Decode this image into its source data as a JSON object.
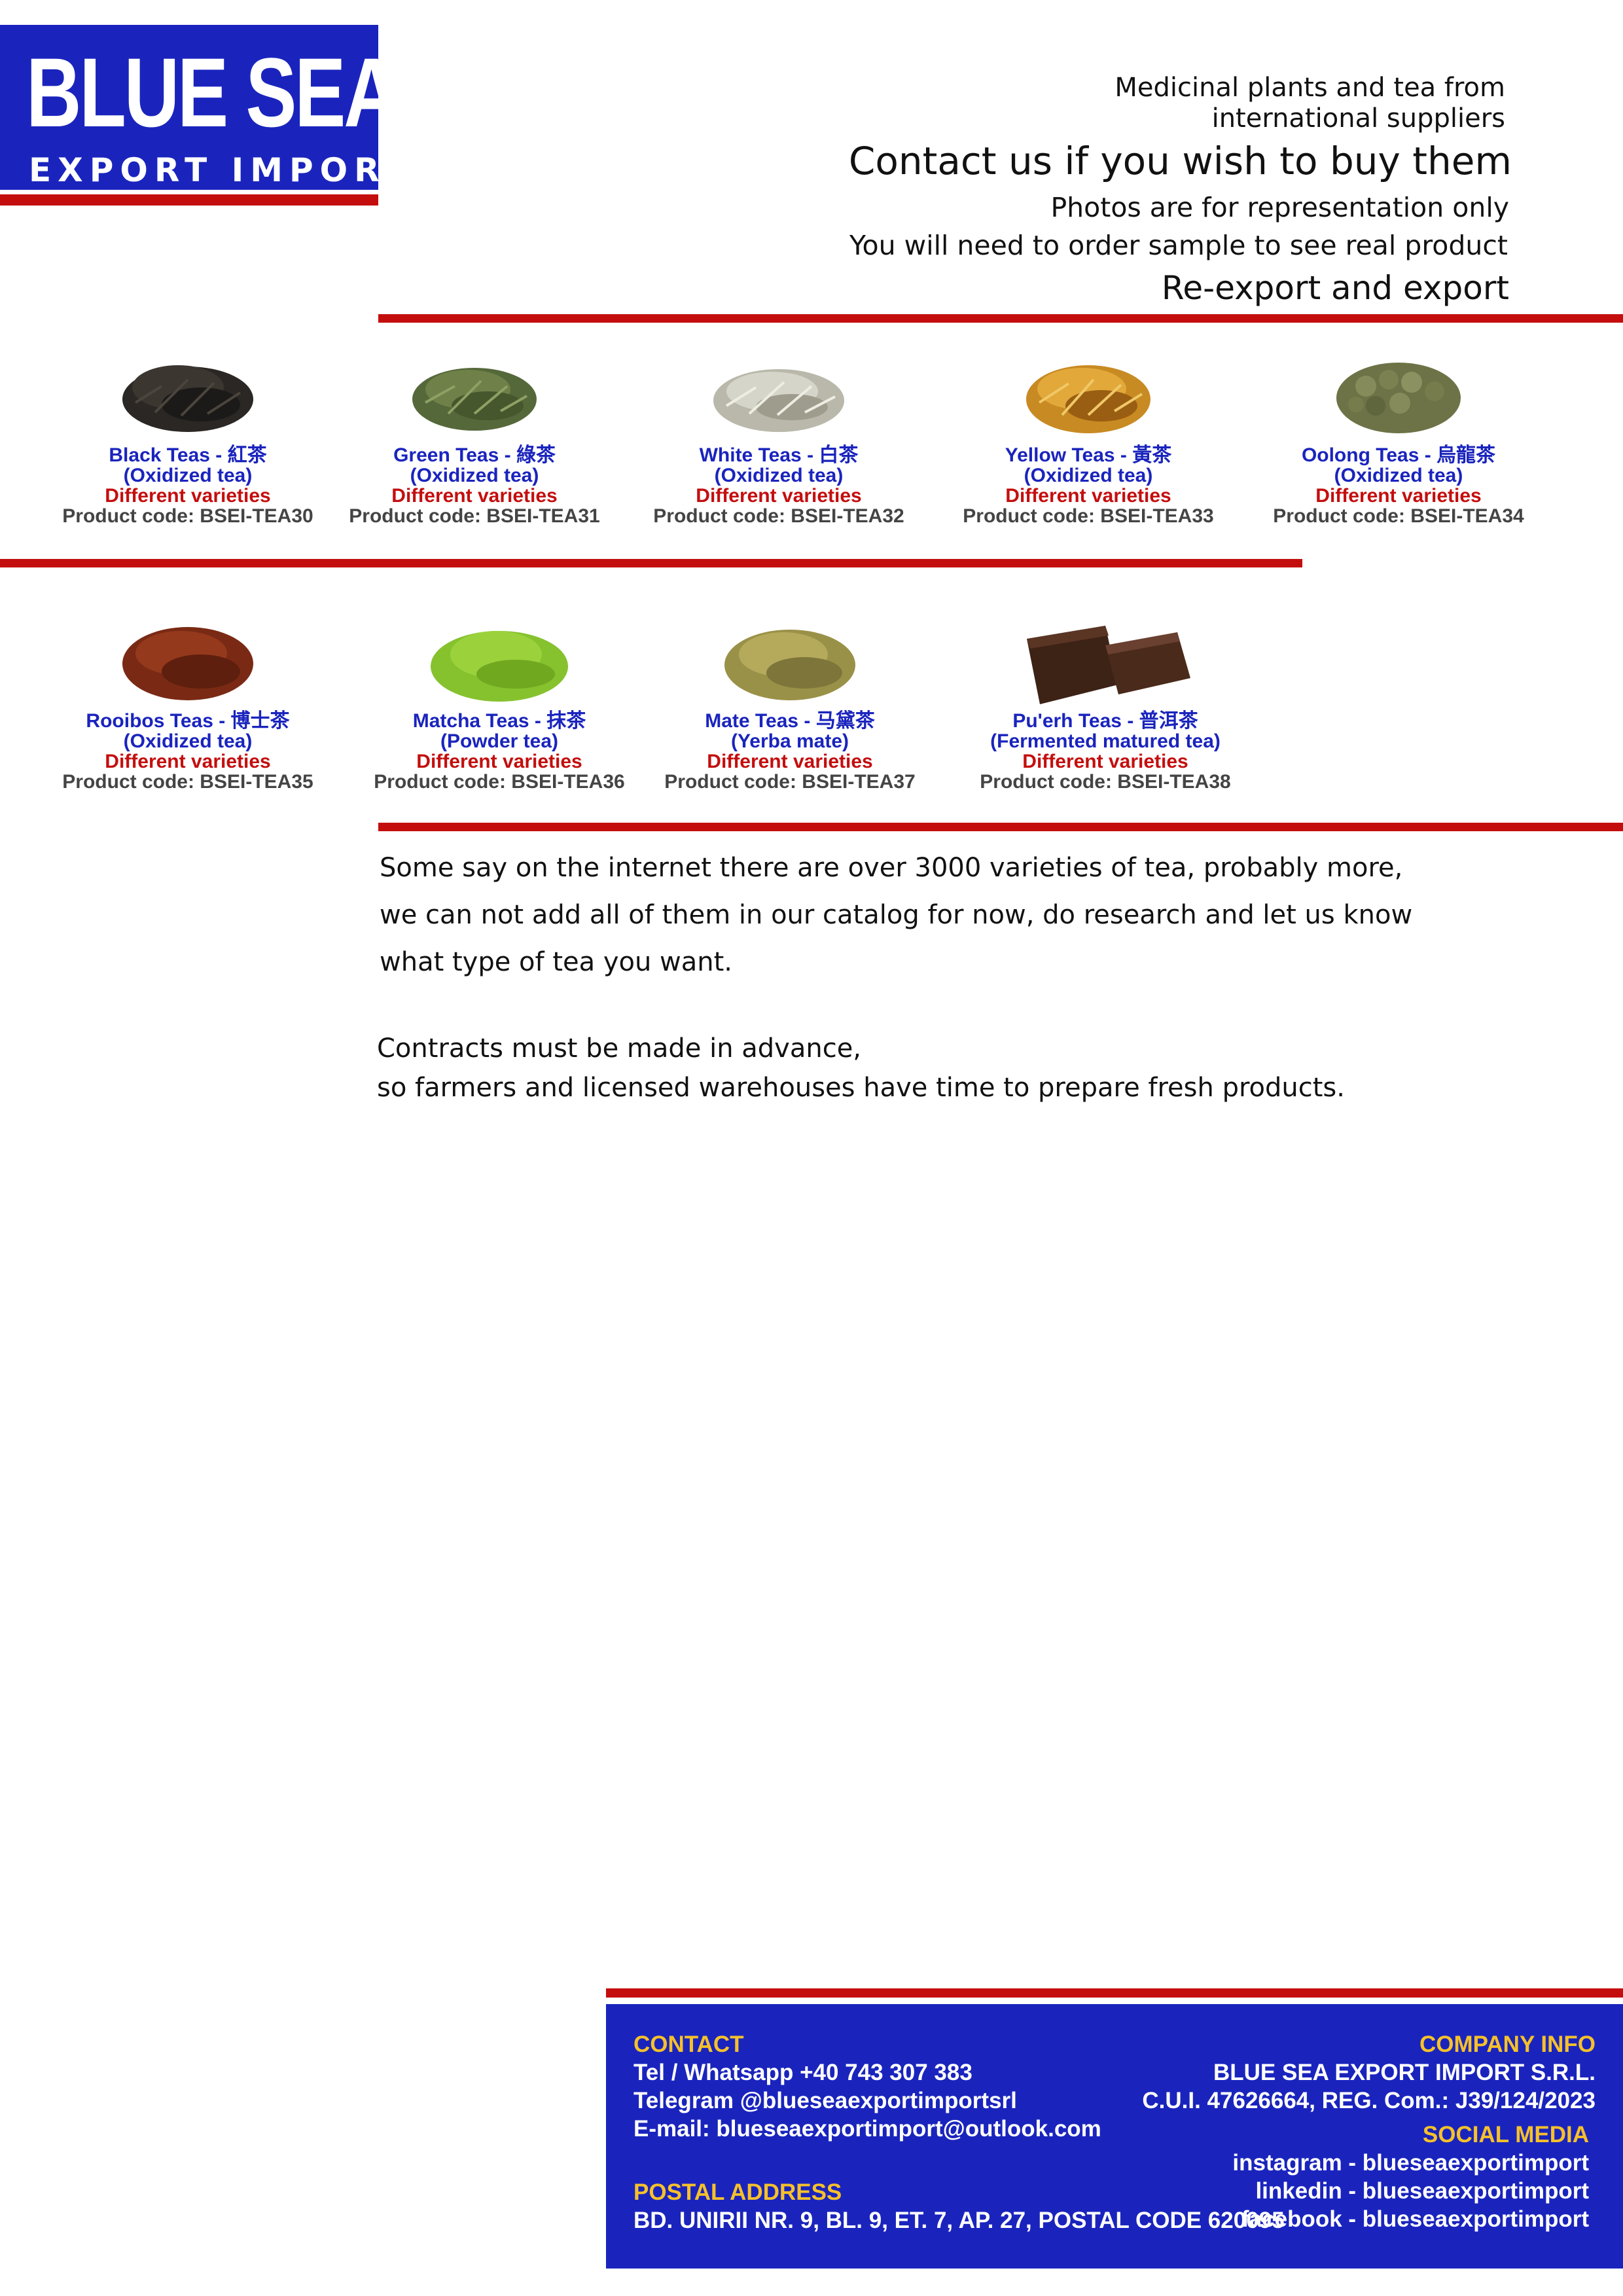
{
  "logo": {
    "line1": "BLUE SEA",
    "line2": "EXPORT IMPORT"
  },
  "header": {
    "line1": "Medicinal plants and tea from",
    "line2": "international suppliers",
    "contact": "Contact us if you wish to buy them",
    "photos": "Photos are for representation only",
    "sample": "You will need to order sample to see real product",
    "reexport": "Re-export and export"
  },
  "colors": {
    "brand_blue": "#1a24bd",
    "accent_red": "#c40e0e",
    "footer_heading": "#f6c12a"
  },
  "products": [
    {
      "name": "Black Teas - 紅茶",
      "sub": "(Oxidized tea)",
      "varieties": "Different varieties",
      "code": "Product code: BSEI-TEA30",
      "icon": "black-tea-leaves"
    },
    {
      "name": "Green Teas - 綠茶",
      "sub": "(Oxidized tea)",
      "varieties": "Different varieties",
      "code": "Product code: BSEI-TEA31",
      "icon": "green-tea-leaves"
    },
    {
      "name": "White Teas - 白茶",
      "sub": "(Oxidized tea)",
      "varieties": "Different varieties",
      "code": "Product code: BSEI-TEA32",
      "icon": "white-tea-leaves"
    },
    {
      "name": "Yellow Teas - 黃茶",
      "sub": "(Oxidized tea)",
      "varieties": "Different varieties",
      "code": "Product code: BSEI-TEA33",
      "icon": "yellow-tea-leaves"
    },
    {
      "name": "Oolong Teas - 烏龍茶",
      "sub": "(Oxidized tea)",
      "varieties": "Different varieties",
      "code": "Product code: BSEI-TEA34",
      "icon": "oolong-tea-pellets"
    },
    {
      "name": "Rooibos Teas - 博士茶",
      "sub": "(Oxidized tea)",
      "varieties": "Different varieties",
      "code": "Product code: BSEI-TEA35",
      "icon": "rooibos-tea"
    },
    {
      "name": "Matcha Teas - 抹茶",
      "sub": "(Powder tea)",
      "varieties": "Different varieties",
      "code": "Product code: BSEI-TEA36",
      "icon": "matcha-powder"
    },
    {
      "name": "Mate Teas - 马黛茶",
      "sub": "(Yerba mate)",
      "varieties": "Different varieties",
      "code": "Product code: BSEI-TEA37",
      "icon": "yerba-mate"
    },
    {
      "name": "Pu'erh Teas - 普洱茶",
      "sub": "(Fermented matured tea)",
      "varieties": "Different varieties",
      "code": "Product code: BSEI-TEA38",
      "icon": "puerh-brick"
    }
  ],
  "info": {
    "line1": "Some say on the internet there are over 3000 varieties of tea, probably more,",
    "line2": "we can not add all of them in our catalog for now, do research and let us know",
    "line3": "what type of tea you want.",
    "line4": "Contracts must be made in advance,",
    "line5": "so farmers and licensed warehouses have time to prepare fresh products."
  },
  "footer": {
    "contact_heading": "CONTACT",
    "phone": "Tel / Whatsapp +40 743 307 383",
    "telegram": "Telegram @blueseaexportimportsrl",
    "email": "E-mail: blueseaexportimport@outlook.com",
    "postal_heading": "POSTAL ADDRESS",
    "address": "BD. UNIRII NR. 9, BL. 9, ET. 7, AP. 27, POSTAL CODE 620095",
    "company_heading": "COMPANY INFO",
    "company_name": "BLUE SEA EXPORT IMPORT S.R.L.",
    "company_reg": "C.U.I. 47626664, REG. Com.: J39/124/2023",
    "social_heading": "SOCIAL MEDIA",
    "instagram": "instagram - blueseaexportimport",
    "linkedin": "linkedin - blueseaexportimport",
    "facebook": "facebook - blueseaexportimport"
  }
}
